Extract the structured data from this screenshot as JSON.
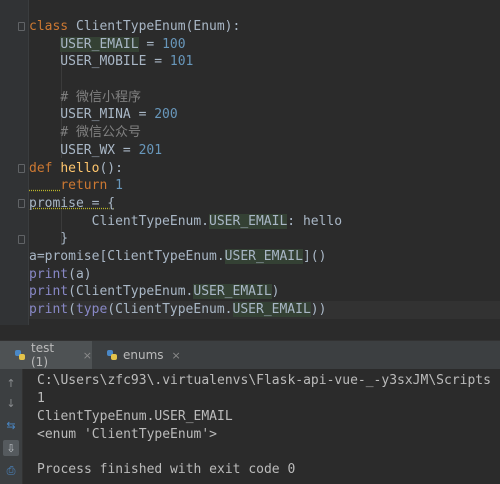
{
  "editor": {
    "lines": [
      {
        "segments": [
          {
            "t": "class ",
            "c": "kw"
          },
          {
            "t": "ClientTypeEnum(Enum):",
            "c": ""
          }
        ]
      },
      {
        "segments": [
          {
            "t": "    ",
            "c": ""
          },
          {
            "t": "USER_EMAIL",
            "c": "hl"
          },
          {
            "t": " = ",
            "c": ""
          },
          {
            "t": "100",
            "c": "num"
          }
        ]
      },
      {
        "segments": [
          {
            "t": "    USER_MOBILE = ",
            "c": ""
          },
          {
            "t": "101",
            "c": "num"
          }
        ]
      },
      {
        "segments": []
      },
      {
        "segments": [
          {
            "t": "    ",
            "c": ""
          },
          {
            "t": "# 微信小程序",
            "c": "cmt"
          }
        ]
      },
      {
        "segments": [
          {
            "t": "    USER_MINA = ",
            "c": ""
          },
          {
            "t": "200",
            "c": "num"
          }
        ]
      },
      {
        "segments": [
          {
            "t": "    ",
            "c": ""
          },
          {
            "t": "# 微信公众号",
            "c": "cmt"
          }
        ]
      },
      {
        "segments": [
          {
            "t": "    USER_WX = ",
            "c": ""
          },
          {
            "t": "201",
            "c": "num"
          }
        ]
      },
      {
        "segments": [
          {
            "t": "def ",
            "c": "kw"
          },
          {
            "t": "hello",
            "c": "fn"
          },
          {
            "t": "():",
            "c": ""
          }
        ]
      },
      {
        "segments": [
          {
            "t": "    ",
            "c": "u"
          },
          {
            "t": "return ",
            "c": "kw"
          },
          {
            "t": "1",
            "c": "num"
          }
        ]
      },
      {
        "segments": [
          {
            "t": "promise = {",
            "c": "u"
          }
        ]
      },
      {
        "segments": [
          {
            "t": "        ClientTypeEnum.",
            "c": ""
          },
          {
            "t": "USER_EMAIL",
            "c": "hl"
          },
          {
            "t": ": hello",
            "c": ""
          }
        ]
      },
      {
        "segments": [
          {
            "t": "    }",
            "c": ""
          }
        ]
      },
      {
        "segments": [
          {
            "t": "a=promise[ClientTypeEnum.",
            "c": ""
          },
          {
            "t": "USER_EMAIL",
            "c": "hl"
          },
          {
            "t": "]()",
            "c": ""
          }
        ]
      },
      {
        "segments": [
          {
            "t": "print",
            "c": "bi"
          },
          {
            "t": "(a)",
            "c": ""
          }
        ]
      },
      {
        "segments": [
          {
            "t": "print",
            "c": "bi"
          },
          {
            "t": "(ClientTypeEnum.",
            "c": ""
          },
          {
            "t": "USER_EMAIL",
            "c": "hl"
          },
          {
            "t": ")",
            "c": ""
          }
        ]
      },
      {
        "segments": [
          {
            "t": "print",
            "c": "bi"
          },
          {
            "t": "(",
            "c": ""
          },
          {
            "t": "type",
            "c": "bi"
          },
          {
            "t": "(ClientTypeEnum.",
            "c": ""
          },
          {
            "t": "USER_EMAIL",
            "c": "hl"
          },
          {
            "t": "))",
            "c": ""
          }
        ]
      }
    ]
  },
  "run_tabs": [
    {
      "label": "test (1)",
      "close": "×",
      "active": true
    },
    {
      "label": "enums",
      "close": "×",
      "active": false
    }
  ],
  "console": {
    "lines": [
      "C:\\Users\\zfc93\\.virtualenvs\\Flask-api-vue-_-y3sxJM\\Scripts",
      "1",
      "ClientTypeEnum.USER_EMAIL",
      "<enum 'ClientTypeEnum'>",
      "",
      "Process finished with exit code 0"
    ]
  },
  "side_tools": [
    {
      "name": "arrow-up-icon",
      "glyph": "↑"
    },
    {
      "name": "arrow-down-icon",
      "glyph": "↓"
    },
    {
      "name": "soft-wrap-icon",
      "glyph": "⇆"
    },
    {
      "name": "scroll-to-end-icon",
      "glyph": "⇩"
    },
    {
      "name": "print-icon",
      "glyph": "⎙"
    }
  ],
  "colors": {
    "keyword": "#cc7832",
    "number": "#6897bb",
    "comment": "#808080",
    "function": "#ffc66d",
    "builtin": "#8888c6",
    "text": "#a9b7c6",
    "background": "#2b2b2b"
  }
}
